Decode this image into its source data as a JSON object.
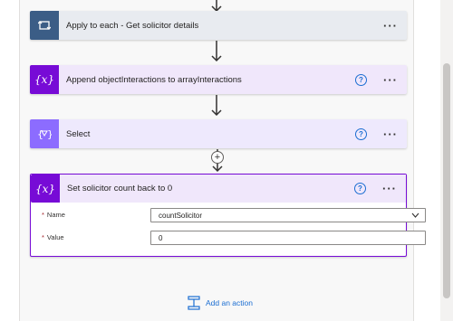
{
  "flow": {
    "steps": [
      {
        "title": "Apply to each - Get solicitor details",
        "icon": "loop-icon",
        "color": "#3b5d86"
      },
      {
        "title": "Append objectInteractions to arrayInteractions",
        "icon": "variable-icon",
        "color": "#770bd6"
      },
      {
        "title": "Select",
        "icon": "data-operation-icon",
        "color": "#8c6cff"
      },
      {
        "title": "Set solicitor count back to 0",
        "icon": "variable-icon",
        "color": "#770bd6"
      }
    ],
    "icon_glyph_variable": "{x}",
    "help_glyph": "?",
    "more_glyph": "···",
    "plus_glyph": "+",
    "fields": {
      "name_label": "Name",
      "name_value": "countSolicitor",
      "value_label": "Value",
      "value_value": "0",
      "required_marker": "*"
    },
    "add_action_label": "Add an action"
  },
  "colors": {
    "loop": "#3b5d86",
    "variable": "#770bd6",
    "data_op": "#8c6cff",
    "link": "#1b6ed2"
  }
}
